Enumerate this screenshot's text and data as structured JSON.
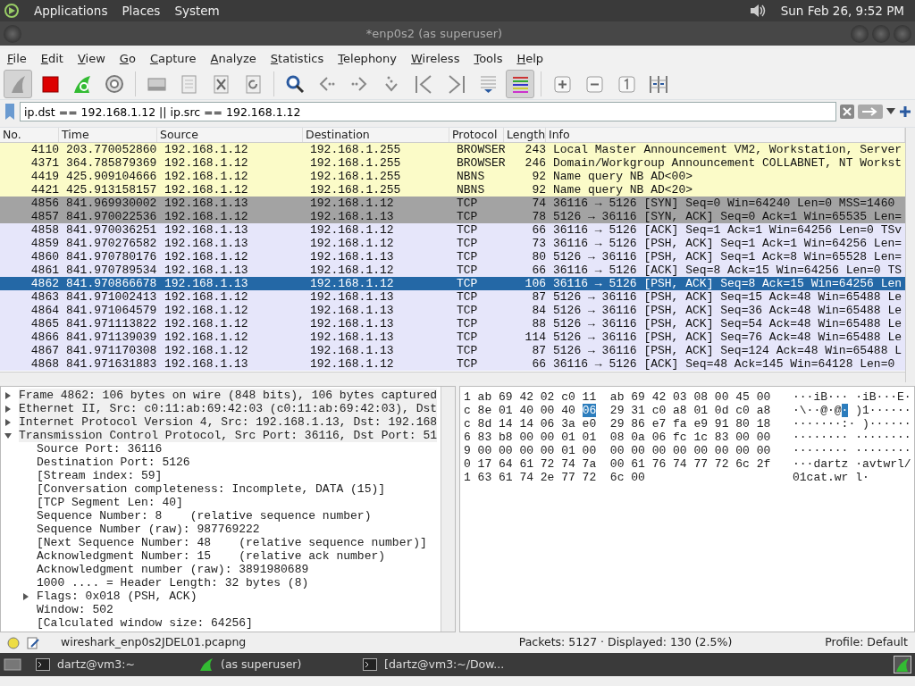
{
  "top_panel": {
    "menus": [
      "Applications",
      "Places",
      "System"
    ],
    "clock": "Sun Feb 26,  9:52 PM"
  },
  "window": {
    "title": "*enp0s2 (as superuser)"
  },
  "menu": [
    "File",
    "Edit",
    "View",
    "Go",
    "Capture",
    "Analyze",
    "Statistics",
    "Telephony",
    "Wireless",
    "Tools",
    "Help"
  ],
  "toolbar": [
    {
      "kind": "fin",
      "pressed": true
    },
    {
      "kind": "stop",
      "pressed": false
    },
    {
      "kind": "restart",
      "pressed": false
    },
    {
      "kind": "gear",
      "pressed": false
    },
    {
      "kind": "sep"
    },
    {
      "kind": "folder",
      "pressed": false
    },
    {
      "kind": "file",
      "pressed": false
    },
    {
      "kind": "closefile",
      "pressed": false
    },
    {
      "kind": "reload",
      "pressed": false
    },
    {
      "kind": "sep"
    },
    {
      "kind": "search",
      "pressed": false
    },
    {
      "kind": "back",
      "pressed": false
    },
    {
      "kind": "forward",
      "pressed": false
    },
    {
      "kind": "jump",
      "pressed": false
    },
    {
      "kind": "first",
      "pressed": false
    },
    {
      "kind": "last",
      "pressed": false
    },
    {
      "kind": "autoscroll",
      "pressed": false
    },
    {
      "kind": "colorize",
      "pressed": true
    },
    {
      "kind": "sep"
    },
    {
      "kind": "zoomin",
      "pressed": false
    },
    {
      "kind": "zoomout",
      "pressed": false
    },
    {
      "kind": "normal",
      "pressed": false
    },
    {
      "kind": "resize",
      "pressed": false
    }
  ],
  "filter": {
    "value": "ip.dst == 192.168.1.12 || ip.src == 192.168.1.12"
  },
  "packet_list": {
    "columns": [
      "No.",
      "Time",
      "Source",
      "Destination",
      "Protocol",
      "Length",
      "Info"
    ],
    "rows": [
      {
        "cells": [
          "4110",
          "203.770052860",
          "192.168.1.12",
          "192.168.1.255",
          "BROWSER",
          "243",
          "Local Master Announcement VM2, Workstation, Server"
        ],
        "color": "#fbfbc8",
        "selected": false
      },
      {
        "cells": [
          "4371",
          "364.785879369",
          "192.168.1.12",
          "192.168.1.255",
          "BROWSER",
          "246",
          "Domain/Workgroup Announcement COLLABNET, NT Workst"
        ],
        "color": "#fbfbc8",
        "selected": false
      },
      {
        "cells": [
          "4419",
          "425.909104666",
          "192.168.1.12",
          "192.168.1.255",
          "NBNS",
          "92",
          "Name query NB AD<00>"
        ],
        "color": "#fbfbc8",
        "selected": false
      },
      {
        "cells": [
          "4421",
          "425.913158157",
          "192.168.1.12",
          "192.168.1.255",
          "NBNS",
          "92",
          "Name query NB AD<20>"
        ],
        "color": "#fbfbc8",
        "selected": false
      },
      {
        "cells": [
          "4856",
          "841.969930002",
          "192.168.1.13",
          "192.168.1.12",
          "TCP",
          "74",
          "36116 → 5126 [SYN] Seq=0 Win=64240 Len=0 MSS=1460"
        ],
        "color": "#a3a3a3",
        "selected": false
      },
      {
        "cells": [
          "4857",
          "841.970022536",
          "192.168.1.12",
          "192.168.1.13",
          "TCP",
          "78",
          "5126 → 36116 [SYN, ACK] Seq=0 Ack=1 Win=65535 Len="
        ],
        "color": "#a3a3a3",
        "selected": false
      },
      {
        "cells": [
          "4858",
          "841.970036251",
          "192.168.1.13",
          "192.168.1.12",
          "TCP",
          "66",
          "36116 → 5126 [ACK] Seq=1 Ack=1 Win=64256 Len=0 TSv"
        ],
        "color": "#e6e6fa",
        "selected": false
      },
      {
        "cells": [
          "4859",
          "841.970276582",
          "192.168.1.13",
          "192.168.1.12",
          "TCP",
          "73",
          "36116 → 5126 [PSH, ACK] Seq=1 Ack=1 Win=64256 Len="
        ],
        "color": "#e6e6fa",
        "selected": false
      },
      {
        "cells": [
          "4860",
          "841.970780176",
          "192.168.1.12",
          "192.168.1.13",
          "TCP",
          "80",
          "5126 → 36116 [PSH, ACK] Seq=1 Ack=8 Win=65528 Len="
        ],
        "color": "#e6e6fa",
        "selected": false
      },
      {
        "cells": [
          "4861",
          "841.970789534",
          "192.168.1.13",
          "192.168.1.12",
          "TCP",
          "66",
          "36116 → 5126 [ACK] Seq=8 Ack=15 Win=64256 Len=0 TS"
        ],
        "color": "#e6e6fa",
        "selected": false
      },
      {
        "cells": [
          "4862",
          "841.970866678",
          "192.168.1.13",
          "192.168.1.12",
          "TCP",
          "106",
          "36116 → 5126 [PSH, ACK] Seq=8 Ack=15 Win=64256 Len"
        ],
        "selected": true
      },
      {
        "cells": [
          "4863",
          "841.971002413",
          "192.168.1.12",
          "192.168.1.13",
          "TCP",
          "87",
          "5126 → 36116 [PSH, ACK] Seq=15 Ack=48 Win=65488 Le"
        ],
        "color": "#e6e6fa",
        "selected": false
      },
      {
        "cells": [
          "4864",
          "841.971064579",
          "192.168.1.12",
          "192.168.1.13",
          "TCP",
          "84",
          "5126 → 36116 [PSH, ACK] Seq=36 Ack=48 Win=65488 Le"
        ],
        "color": "#e6e6fa",
        "selected": false
      },
      {
        "cells": [
          "4865",
          "841.971113822",
          "192.168.1.12",
          "192.168.1.13",
          "TCP",
          "88",
          "5126 → 36116 [PSH, ACK] Seq=54 Ack=48 Win=65488 Le"
        ],
        "color": "#e6e6fa",
        "selected": false
      },
      {
        "cells": [
          "4866",
          "841.971139039",
          "192.168.1.12",
          "192.168.1.13",
          "TCP",
          "114",
          "5126 → 36116 [PSH, ACK] Seq=76 Ack=48 Win=65488 Le"
        ],
        "color": "#e6e6fa",
        "selected": false
      },
      {
        "cells": [
          "4867",
          "841.971170308",
          "192.168.1.12",
          "192.168.1.13",
          "TCP",
          "87",
          "5126 → 36116 [PSH, ACK] Seq=124 Ack=48 Win=65488 L"
        ],
        "color": "#e6e6fa",
        "selected": false
      },
      {
        "cells": [
          "4868",
          "841.971631883",
          "192.168.1.13",
          "192.168.1.12",
          "TCP",
          "66",
          "36116 → 5126 [ACK] Seq=48 Ack=145 Win=64128 Len=0"
        ],
        "color": "#e6e6fa",
        "selected": false
      }
    ]
  },
  "details": [
    {
      "label": "Frame 4862: 106 bytes on wire (848 bits), 106 bytes captured",
      "kind": "branch",
      "expanded": false
    },
    {
      "label": "Ethernet II, Src: c0:11:ab:69:42:03 (c0:11:ab:69:42:03), Dst",
      "kind": "branch",
      "expanded": false
    },
    {
      "label": "Internet Protocol Version 4, Src: 192.168.1.13, Dst: 192.168",
      "kind": "branch",
      "expanded": false
    },
    {
      "label": "Transmission Control Protocol, Src Port: 36116, Dst Port: 51",
      "kind": "branch",
      "expanded": true,
      "children": [
        {
          "label": "Source Port: 36116",
          "kind": "leaf"
        },
        {
          "label": "Destination Port: 5126",
          "kind": "leaf"
        },
        {
          "label": "[Stream index: 59]",
          "kind": "leaf"
        },
        {
          "label": "[Conversation completeness: Incomplete, DATA (15)]",
          "kind": "leaf"
        },
        {
          "label": "[TCP Segment Len: 40]",
          "kind": "leaf"
        },
        {
          "label": "Sequence Number: 8    (relative sequence number)",
          "kind": "leaf"
        },
        {
          "label": "Sequence Number (raw): 987769222",
          "kind": "leaf"
        },
        {
          "label": "[Next Sequence Number: 48    (relative sequence number)]",
          "kind": "leaf"
        },
        {
          "label": "Acknowledgment Number: 15    (relative ack number)",
          "kind": "leaf"
        },
        {
          "label": "Acknowledgment number (raw): 3891980689",
          "kind": "leaf"
        },
        {
          "label": "1000 .... = Header Length: 32 bytes (8)",
          "kind": "leaf"
        },
        {
          "label": "Flags: 0x018 (PSH, ACK)",
          "kind": "branch",
          "expanded": false
        },
        {
          "label": "Window: 502",
          "kind": "leaf"
        },
        {
          "label": "[Calculated window size: 64256]",
          "kind": "leaf"
        }
      ]
    }
  ],
  "bytes": [
    {
      "hex": [
        {
          "text": "1 ab 69 42 02 c0 11  ab 69 42 03 08 00 45 00",
          "selected": false
        }
      ],
      "ascii": [
        {
          "text": "···iB··· ·iB···E·",
          "selected": false
        }
      ]
    },
    {
      "hex": [
        {
          "text": "c 8e 01 40 00 40 ",
          "selected": false
        },
        {
          "text": "06",
          "selected": true
        },
        {
          "text": "  29 31 c0 a8 01 0d c0 a8",
          "selected": false
        }
      ],
      "ascii": [
        {
          "text": "·\\··@·@",
          "selected": false
        },
        {
          "text": "·",
          "selected": true
        },
        {
          "text": " )1······",
          "selected": false
        }
      ]
    },
    {
      "hex": [
        {
          "text": "c 8d 14 14 06 3a e0  29 86 e7 fa e9 91 80 18",
          "selected": false
        }
      ],
      "ascii": [
        {
          "text": "·······:· )······",
          "selected": false
        }
      ]
    },
    {
      "hex": [
        {
          "text": "6 83 b8 00 00 01 01  08 0a 06 fc 1c 83 00 00",
          "selected": false
        }
      ],
      "ascii": [
        {
          "text": "········ ········",
          "selected": false
        }
      ]
    },
    {
      "hex": [
        {
          "text": "9 00 00 00 00 01 00  00 00 00 00 00 00 00 00",
          "selected": false
        }
      ],
      "ascii": [
        {
          "text": "········ ········",
          "selected": false
        }
      ]
    },
    {
      "hex": [
        {
          "text": "0 17 64 61 72 74 7a  00 61 76 74 77 72 6c 2f",
          "selected": false
        }
      ],
      "ascii": [
        {
          "text": "···dartz ·avtwrl/",
          "selected": false
        }
      ]
    },
    {
      "hex": [
        {
          "text": "1 63 61 74 2e 77 72  6c 00",
          "selected": false
        }
      ],
      "ascii": [
        {
          "text": "01cat.wr l·",
          "selected": false
        }
      ]
    }
  ],
  "status_bar": {
    "file": "wireshark_enp0s2JDEL01.pcapng",
    "packets": "Packets: 5127 · Displayed: 130 (2.5%)",
    "profile": "Profile: Default"
  },
  "taskbar": [
    {
      "kind": "terminal",
      "label": "dartz@vm3:~"
    },
    {
      "kind": "shark",
      "label": "(as superuser)"
    },
    {
      "kind": "terminal",
      "label": "[dartz@vm3:~/Dow..."
    }
  ]
}
